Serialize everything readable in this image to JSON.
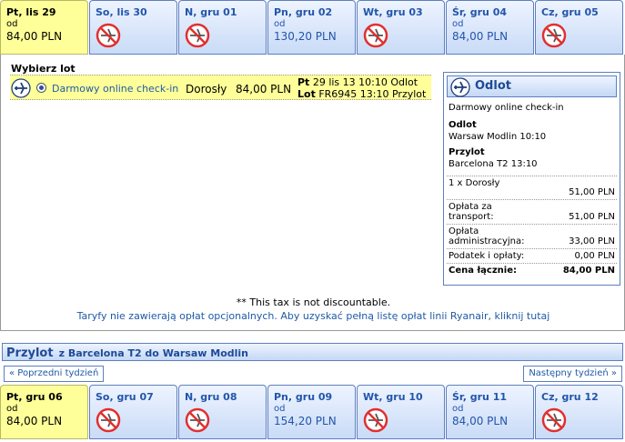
{
  "outbound_days": [
    {
      "name": "Pt, lis 29",
      "from": "od",
      "price": "84,00 PLN",
      "selected": true,
      "available": true
    },
    {
      "name": "So, lis 30",
      "from": "",
      "price": "",
      "selected": false,
      "available": false
    },
    {
      "name": "N, gru 01",
      "from": "",
      "price": "",
      "selected": false,
      "available": false
    },
    {
      "name": "Pn, gru 02",
      "from": "od",
      "price": "130,20 PLN",
      "selected": false,
      "available": true
    },
    {
      "name": "Wt, gru 03",
      "from": "",
      "price": "",
      "selected": false,
      "available": false
    },
    {
      "name": "Śr, gru 04",
      "from": "od",
      "price": "84,00 PLN",
      "selected": false,
      "available": true
    },
    {
      "name": "Cz, gru 05",
      "from": "",
      "price": "",
      "selected": false,
      "available": false
    }
  ],
  "flight_select": {
    "title": "Wybierz lot",
    "checkin_label": "Darmowy online check-in",
    "passenger": "Dorosły",
    "price": "84,00 PLN",
    "day_label": "Pt",
    "date_time": "29 lis 13 10:10 Odlot",
    "flight_label": "Lot",
    "flight_info": "FR6945 13:10 Przylot"
  },
  "summary": {
    "title": "Odlot",
    "checkin": "Darmowy online check-in",
    "dep_label": "Odlot",
    "dep_value": "Warsaw Modlin 10:10",
    "arr_label": "Przylot",
    "arr_value": "Barcelona T2 13:10",
    "rows": [
      {
        "label": "1 x Dorosły",
        "value": "51,00 PLN"
      },
      {
        "label": "Opłata za transport:",
        "value": "51,00 PLN"
      },
      {
        "label": "Opłata administracyjna:",
        "value": "33,00 PLN"
      },
      {
        "label": "Podatek i opłaty:",
        "value": "0,00 PLN"
      },
      {
        "label": "Cena łącznie:",
        "value": "84,00 PLN"
      }
    ]
  },
  "notes": {
    "tax": "** This tax is not discountable.",
    "tariff_link": "Taryfy nie zawierają opłat opcjonalnych. Aby uzyskać pełną listę opłat linii Ryanair, kliknij tutaj"
  },
  "return_section": {
    "title": "Przylot",
    "route": "z Barcelona T2 do Warsaw Modlin",
    "prev_week": "« Poprzedni tydzień",
    "next_week": "Następny tydzień »"
  },
  "return_days": [
    {
      "name": "Pt, gru 06",
      "from": "od",
      "price": "84,00 PLN",
      "selected": true,
      "available": true
    },
    {
      "name": "So, gru 07",
      "from": "",
      "price": "",
      "selected": false,
      "available": false
    },
    {
      "name": "N, gru 08",
      "from": "",
      "price": "",
      "selected": false,
      "available": false
    },
    {
      "name": "Pn, gru 09",
      "from": "od",
      "price": "154,20 PLN",
      "selected": false,
      "available": true
    },
    {
      "name": "Wt, gru 10",
      "from": "",
      "price": "",
      "selected": false,
      "available": false
    },
    {
      "name": "Śr, gru 11",
      "from": "od",
      "price": "84,00 PLN",
      "selected": false,
      "available": true
    },
    {
      "name": "Cz, gru 12",
      "from": "",
      "price": "",
      "selected": false,
      "available": false
    }
  ],
  "icons": {
    "plane": "plane-icon",
    "no_flight": "no-flight-icon"
  },
  "colors": {
    "selected": "#ffff99",
    "link": "#1f5aa6",
    "border": "#5d7fbf"
  }
}
